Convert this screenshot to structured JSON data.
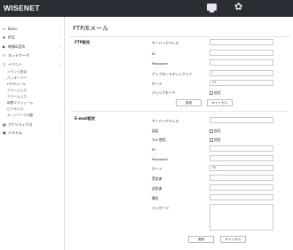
{
  "app": {
    "logo": "WISENET"
  },
  "topbar": {
    "monitor_icon": "monitor-icon",
    "gear_icon": "gear-icon",
    "gear_glyph": "✿"
  },
  "sidebar": {
    "items": [
      {
        "label": "Basic",
        "icon": "▭",
        "chevron": "›"
      },
      {
        "label": "PTZ",
        "icon": "✥",
        "chevron": "›"
      },
      {
        "label": "映像&音声",
        "icon": "▶",
        "chevron": "›"
      },
      {
        "label": "ネットワーク",
        "icon": "⚇",
        "chevron": "›"
      },
      {
        "label": "イベント",
        "icon": "♫",
        "chevron": "⌄"
      }
    ],
    "subitems": [
      "イベント設定",
      "パンオーバー",
      "FTP/Eメール",
      "アラーム入力",
      "アラーム入力",
      "時間スケジュール",
      "ビデオロス",
      "ネットワーク切断"
    ],
    "bottom_items": [
      {
        "label": "アナリティクス",
        "icon": "▦",
        "chevron": "›"
      },
      {
        "label": "システム",
        "icon": "▣",
        "chevron": "›"
      }
    ]
  },
  "main": {
    "title": "FTP/Eメール",
    "ftp": {
      "section_title": "FTP設定",
      "labels": [
        "サーバーアドレス",
        "ID",
        "Password",
        "アップロードディレクトリ",
        "ポート",
        "パッシブモード"
      ],
      "values": [
        "",
        "",
        "",
        "/",
        "21"
      ],
      "passive_check_label": "使用",
      "apply": "適用",
      "cancel": "キャンセル"
    },
    "email": {
      "section_title": "E-mail設定",
      "labels": [
        "サーバーアドレス",
        "認証",
        "TLS 使用",
        "ID",
        "Password",
        "ポート",
        "受信者",
        "送信者",
        "題名",
        "メッセージ"
      ],
      "auth_check_label": "使用",
      "tls_check_label": "使用",
      "port_value": "25",
      "apply": "適用",
      "cancel": "キャンセル"
    }
  }
}
